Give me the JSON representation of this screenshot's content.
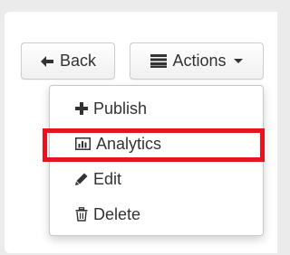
{
  "toolbar": {
    "back_label": "Back",
    "back_icon": "arrow-left-icon",
    "actions_label": "Actions",
    "actions_icon": "list-icon"
  },
  "menu": {
    "items": [
      {
        "label": "Publish",
        "icon": "plus-icon"
      },
      {
        "label": "Analytics",
        "icon": "bar-chart-icon"
      },
      {
        "label": "Edit",
        "icon": "pencil-icon"
      },
      {
        "label": "Delete",
        "icon": "trash-icon"
      }
    ],
    "highlighted_item": "Analytics"
  },
  "colors": {
    "highlight": "#e8141c",
    "text": "#333333",
    "background": "#ebebeb"
  }
}
